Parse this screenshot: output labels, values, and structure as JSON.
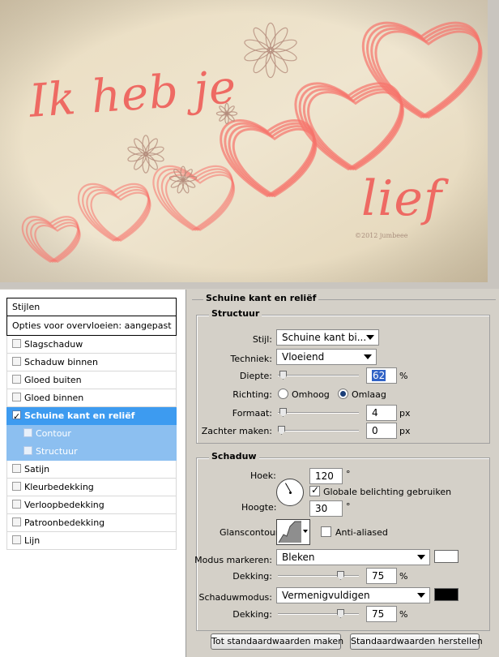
{
  "artwork": {
    "line1": "Ik heb je",
    "line2": "lief",
    "copyright": "©2012 jumbeee",
    "colors": {
      "paper": "#e8dcc3",
      "text": "#ee6a63",
      "hearts": "#f7736b",
      "flowers": "#b48c7c"
    }
  },
  "styles": {
    "header": "Stijlen",
    "blend_options": "Opties voor overvloeien: aangepast",
    "items": [
      {
        "label": "Slagschaduw",
        "checked": false
      },
      {
        "label": "Schaduw binnen",
        "checked": false
      },
      {
        "label": "Gloed buiten",
        "checked": false
      },
      {
        "label": "Gloed binnen",
        "checked": false
      },
      {
        "label": "Schuine kant en reliëf",
        "checked": true
      },
      {
        "label": "Contour",
        "checked": false
      },
      {
        "label": "Structuur",
        "checked": false
      },
      {
        "label": "Satijn",
        "checked": false
      },
      {
        "label": "Kleurbedekking",
        "checked": false
      },
      {
        "label": "Verloopbedekking",
        "checked": false
      },
      {
        "label": "Patroonbedekking",
        "checked": false
      },
      {
        "label": "Lijn",
        "checked": false
      }
    ],
    "colors": {
      "selected": "#3d9bf0",
      "sub": "#8cbff0"
    }
  },
  "options": {
    "section_title": "Schuine kant en reliëf",
    "structure": {
      "title": "Structuur",
      "style_label": "Stijl:",
      "style_value": "Schuine kant bi...",
      "technique_label": "Techniek:",
      "technique_value": "Vloeiend",
      "depth_label": "Diepte:",
      "depth_value": "62",
      "depth_unit": "%",
      "direction_label": "Richting:",
      "direction_up": "Omhoog",
      "direction_down": "Omlaag",
      "direction_selected": "down",
      "size_label": "Formaat:",
      "size_value": "4",
      "size_unit": "px",
      "soften_label": "Zachter maken:",
      "soften_value": "0",
      "soften_unit": "px"
    },
    "shading": {
      "title": "Schaduw",
      "angle_label": "Hoek:",
      "angle_value": "120",
      "angle_unit": "°",
      "global_light_label": "Globale belichting gebruiken",
      "global_light_checked": true,
      "altitude_label": "Hoogte:",
      "altitude_value": "30",
      "altitude_unit": "°",
      "gloss_label": "Glanscontour:",
      "anti_aliased_label": "Anti-aliased",
      "anti_aliased_checked": false,
      "highlight_mode_label": "Modus markeren:",
      "highlight_mode_value": "Bleken",
      "highlight_color": "#ffffff",
      "highlight_opacity_label": "Dekking:",
      "highlight_opacity_value": "75",
      "highlight_opacity_unit": "%",
      "shadow_mode_label": "Schaduwmodus:",
      "shadow_mode_value": "Vermenigvuldigen",
      "shadow_color": "#000000",
      "shadow_opacity_label": "Dekking:",
      "shadow_opacity_value": "75",
      "shadow_opacity_unit": "%"
    },
    "buttons": {
      "make_default": "Tot standaardwaarden maken",
      "reset_default": "Standaardwaarden herstellen"
    }
  }
}
